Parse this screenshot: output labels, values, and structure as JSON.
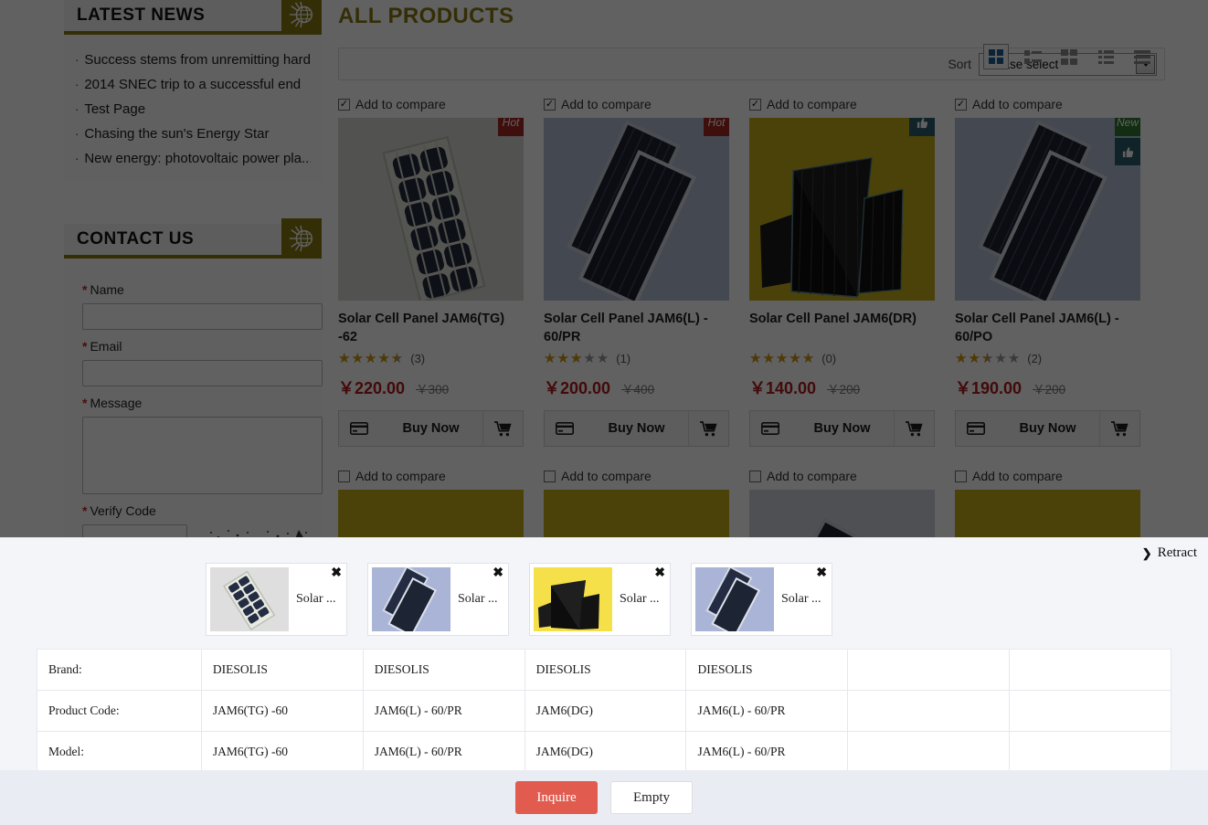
{
  "sidebar": {
    "news_panel": {
      "title": "LATEST NEWS",
      "items": [
        "Success stems from unremitting hard!",
        "2014 SNEC trip to a successful end",
        "Test Page",
        "Chasing the sun's Energy Star",
        "New energy: photovoltaic power pla..."
      ]
    },
    "contact_panel": {
      "title": "CONTACT US",
      "name_label": "Name",
      "email_label": "Email",
      "message_label": "Message",
      "verify_label": "Verify Code",
      "required_mark": "*",
      "name_value": "",
      "email_value": "",
      "message_value": "",
      "verify_value": ""
    }
  },
  "main": {
    "title": "ALL PRODUCTS",
    "toolbar": {
      "sort_label": "Sort",
      "sort_value": "Please select",
      "view_modes": [
        {
          "name": "grid-view",
          "active": true
        },
        {
          "name": "list-view-small",
          "active": false
        },
        {
          "name": "list-view-medium",
          "active": false
        },
        {
          "name": "list-view-compact",
          "active": false
        },
        {
          "name": "list-view-rows",
          "active": false
        }
      ]
    },
    "compare_label": "Add to compare",
    "buy_label": "Buy Now",
    "products": [
      {
        "name": "Solar Cell Panel JAM6(TG) -62",
        "rating": 4.5,
        "rating_count": "(3)",
        "price": "￥220.00",
        "old_price": "￥300",
        "badge": "Hot",
        "badge_type": "hot",
        "liked": false,
        "checked": true
      },
      {
        "name": "Solar Cell Panel JAM6(L) - 60/PR",
        "rating": 3,
        "rating_count": "(1)",
        "price": "￥200.00",
        "old_price": "￥400",
        "badge": "Hot",
        "badge_type": "hot",
        "liked": false,
        "checked": true
      },
      {
        "name": "Solar Cell Panel JAM6(DR)",
        "rating": 5,
        "rating_count": "(0)",
        "price": "￥140.00",
        "old_price": "￥200",
        "badge": "",
        "badge_type": "none",
        "liked": true,
        "checked": true
      },
      {
        "name": "Solar Cell Panel JAM6(L) - 60/PO",
        "rating": 2.5,
        "rating_count": "(2)",
        "price": "￥190.00",
        "old_price": "￥200",
        "badge": "New",
        "badge_type": "new",
        "liked": true,
        "checked": true
      }
    ],
    "products_row2": [
      {
        "checked": false
      },
      {
        "checked": false
      },
      {
        "checked": false
      },
      {
        "checked": false
      }
    ]
  },
  "compare_drawer": {
    "retract_label": "Retract",
    "remove_icon": "✖",
    "items": [
      {
        "title": "Solar ...",
        "bg": "#dedede"
      },
      {
        "title": "Solar ...",
        "bg": "#aab4d6"
      },
      {
        "title": "Solar ...",
        "bg": "#f5e04a"
      },
      {
        "title": "Solar ...",
        "bg": "#aab4d6"
      }
    ],
    "rows": [
      {
        "key": "Brand:",
        "values": [
          "DIESOLIS",
          "DIESOLIS",
          "DIESOLIS",
          "DIESOLIS",
          "",
          ""
        ]
      },
      {
        "key": "Product Code:",
        "values": [
          "JAM6(TG) -60",
          "JAM6(L) - 60/PR",
          "JAM6(DG)",
          "JAM6(L) - 60/PR",
          "",
          ""
        ]
      },
      {
        "key": "Model:",
        "values": [
          "JAM6(TG) -60",
          "JAM6(L) - 60/PR",
          "JAM6(DG)",
          "JAM6(L) - 60/PR",
          "",
          ""
        ]
      }
    ],
    "inquire_label": "Inquire",
    "empty_label": "Empty"
  },
  "colors": {
    "brand_gold": "#8a7a12",
    "price_red": "#b01b1b",
    "badge_hot": "#a32823",
    "badge_new": "#31762e",
    "badge_like": "#2c5c6b",
    "grid_icon_blue": "#1b5e92",
    "inquire_red": "#e15b4f",
    "drawer_bg": "#f4f5f9"
  }
}
